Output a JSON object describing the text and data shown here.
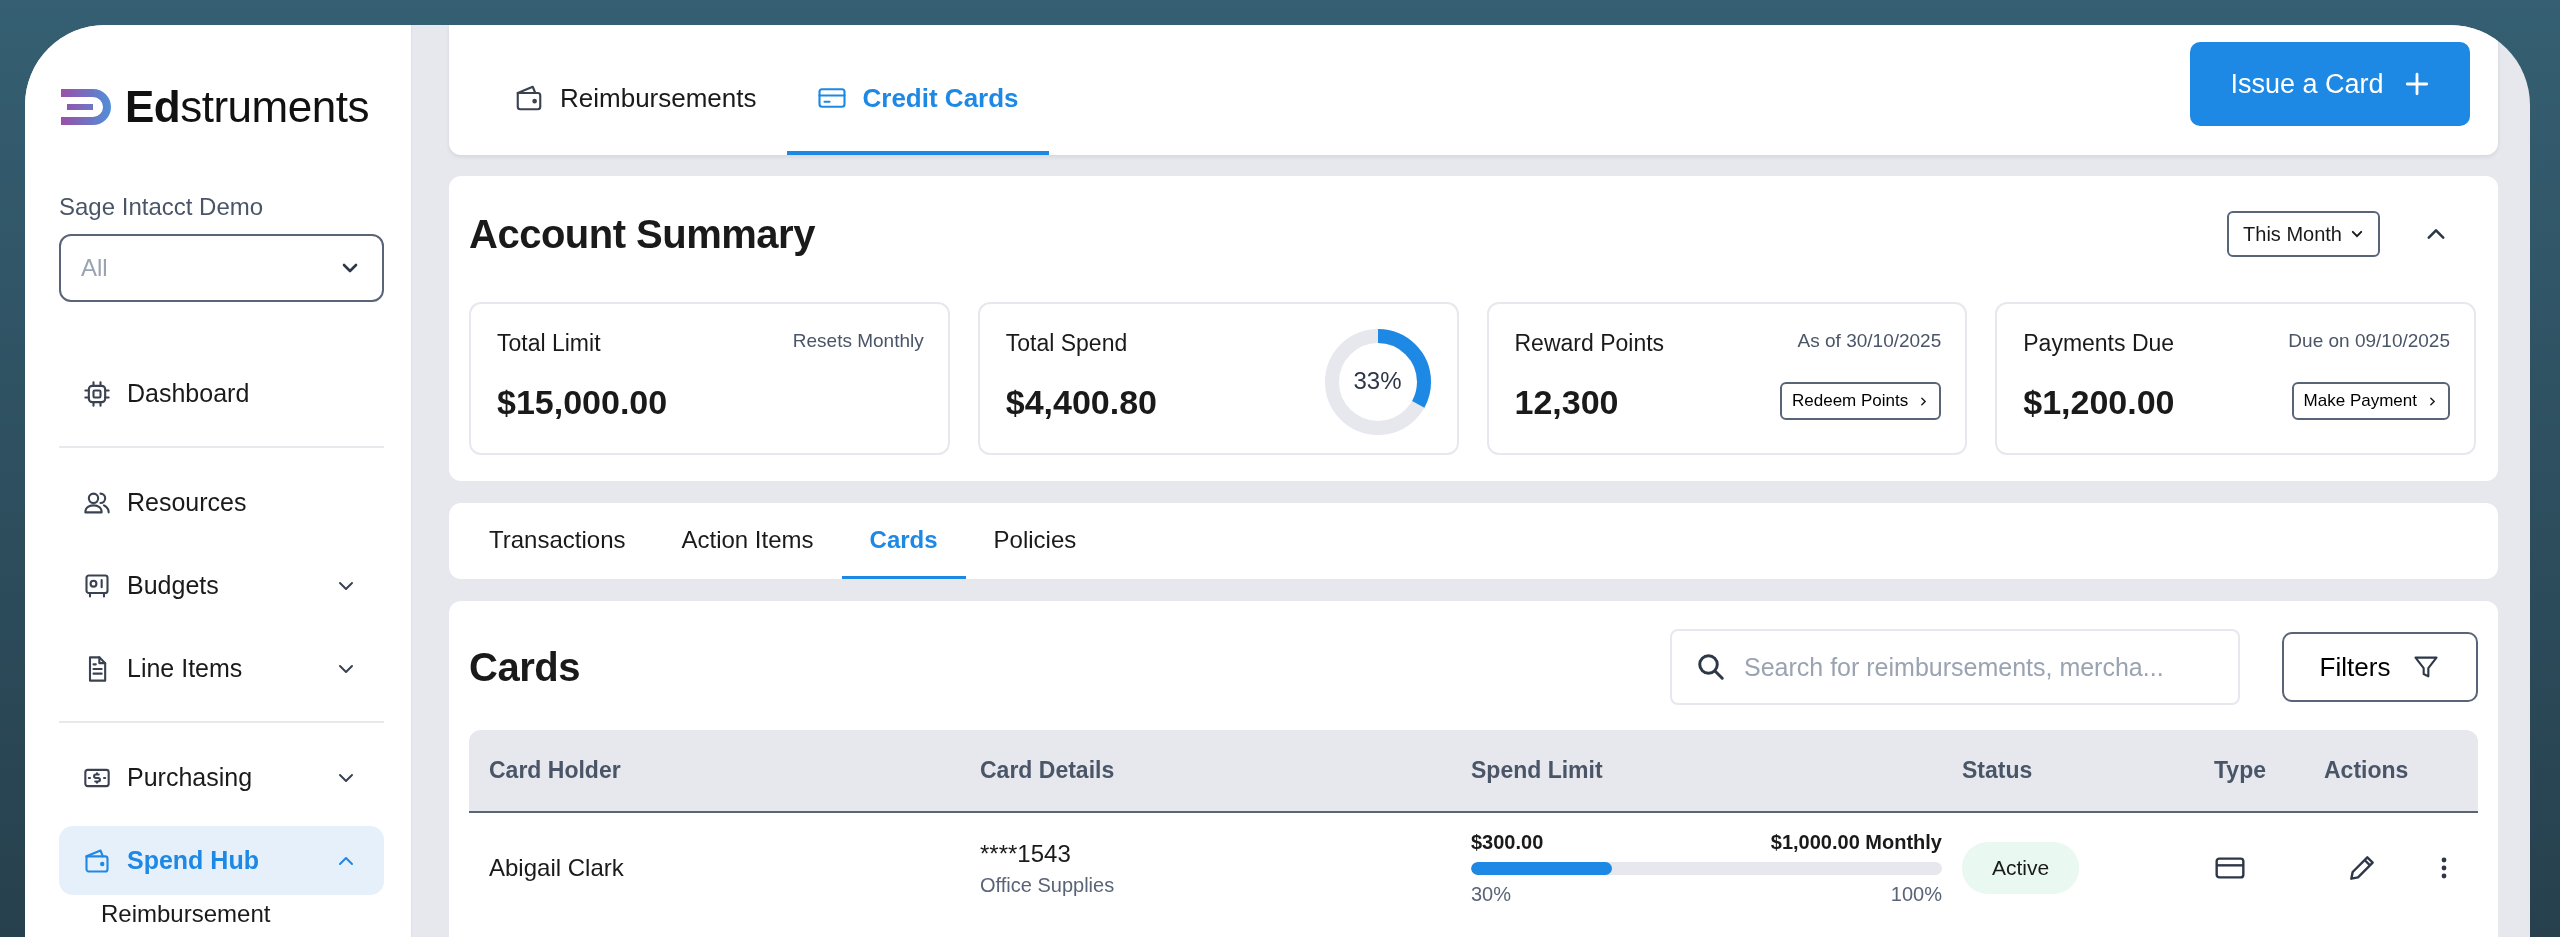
{
  "brand": {
    "name": "**Ed**struments"
  },
  "sidebar": {
    "org_label": "Sage Intacct Demo",
    "org_select": {
      "placeholder": "All"
    },
    "groups": [
      [
        {
          "label": "Dashboard",
          "selected": false
        }
      ],
      [
        {
          "label": "Resources",
          "selected": false
        },
        {
          "label": "Budgets",
          "selected": false,
          "expanded": false
        },
        {
          "label": "Line Items",
          "selected": false,
          "expanded": false
        }
      ],
      [
        {
          "label": "Purchasing",
          "selected": false,
          "expanded": false
        },
        {
          "label": "Spend Hub",
          "selected": true,
          "expanded": true,
          "children": [
            {
              "label": "Reimbursement"
            }
          ]
        }
      ]
    ]
  },
  "top_tabs": [
    {
      "label": "Reimbursements",
      "selected": false
    },
    {
      "label": "Credit Cards",
      "selected": true
    }
  ],
  "issue_button": {
    "label": "Issue a Card"
  },
  "account_summary": {
    "title": "Account Summary",
    "period_select": {
      "value": "This Month"
    },
    "expanded": true,
    "cards": [
      {
        "kind": "plain",
        "title": "Total Limit",
        "note": "Resets Monthly",
        "value": "$15,000.00"
      },
      {
        "kind": "donut",
        "title": "Total Spend",
        "value": "$4,400.80",
        "level": 0.33,
        "reading": "33%"
      },
      {
        "kind": "action",
        "title": "Reward Points",
        "note": "As of 30/10/2025",
        "value": "12,300",
        "action": "Redeem Points"
      },
      {
        "kind": "action",
        "title": "Payments Due",
        "note": "Due on 09/10/2025",
        "value": "$1,200.00",
        "action": "Make Payment"
      }
    ]
  },
  "sub_tabs": [
    {
      "label": "Transactions",
      "selected": false
    },
    {
      "label": "Action Items",
      "selected": false
    },
    {
      "label": "Cards",
      "selected": true
    },
    {
      "label": "Policies",
      "selected": false
    }
  ],
  "cards_panel": {
    "title": "Cards",
    "search": {
      "placeholder": "Search for reimbursements, mercha..."
    },
    "filters_button": "Filters",
    "table": {
      "columns": [
        "Card Holder",
        "Card Details",
        "Spend Limit",
        "Status",
        "Type",
        "Actions"
      ],
      "rows": [
        {
          "holder": "Abigail Clark",
          "card_number": "****1543",
          "category": "Office Supplies",
          "spent": "$300.00",
          "limit": "$1,000.00 Monthly",
          "level": 0.3,
          "min_label": "30%",
          "max_label": "100%",
          "status": "Active"
        }
      ]
    }
  }
}
